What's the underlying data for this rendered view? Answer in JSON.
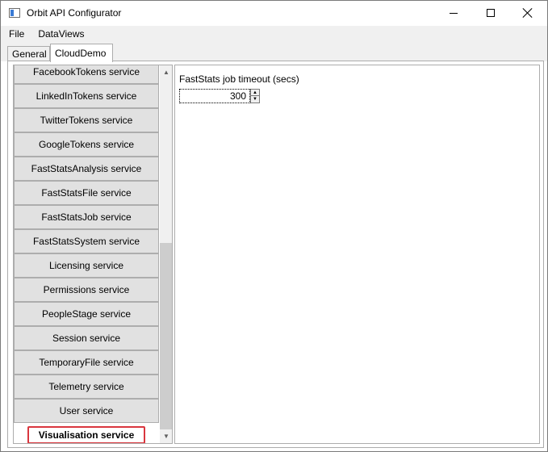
{
  "window": {
    "title": "Orbit API Configurator"
  },
  "menu": {
    "items": [
      {
        "label": "File"
      },
      {
        "label": "DataViews"
      }
    ]
  },
  "tabs": [
    {
      "label": "General",
      "selected": false
    },
    {
      "label": "CloudDemo",
      "selected": true
    }
  ],
  "services": {
    "items": [
      {
        "label": "FacebookTokens service"
      },
      {
        "label": "LinkedInTokens service"
      },
      {
        "label": "TwitterTokens service"
      },
      {
        "label": "GoogleTokens service"
      },
      {
        "label": "FastStatsAnalysis service"
      },
      {
        "label": "FastStatsFile service"
      },
      {
        "label": "FastStatsJob service"
      },
      {
        "label": "FastStatsSystem service"
      },
      {
        "label": "Licensing service"
      },
      {
        "label": "Permissions service"
      },
      {
        "label": "PeopleStage service"
      },
      {
        "label": "Session service"
      },
      {
        "label": "TemporaryFile service"
      },
      {
        "label": "Telemetry service"
      },
      {
        "label": "User service"
      },
      {
        "label": "Visualisation service"
      }
    ],
    "selected": "Visualisation service",
    "highlight_color": "#d9363e"
  },
  "settings": {
    "timeout_label": "FastStats job timeout (secs)",
    "timeout_value": "300"
  }
}
